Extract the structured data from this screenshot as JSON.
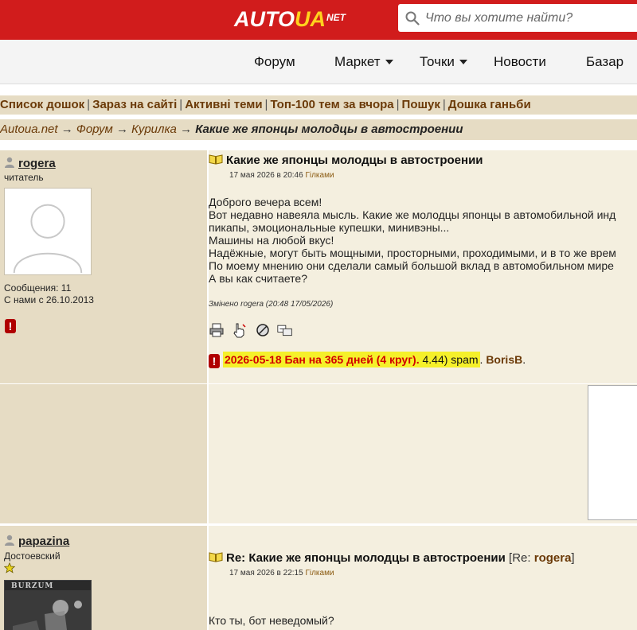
{
  "header": {
    "logo_main": "AUTO",
    "logo_ua": "UA",
    "logo_net": "NET",
    "search_placeholder": "Что вы хотите найти?",
    "colors": {
      "brand_red": "#d11c1c",
      "logo_yellow": "#ffd21e"
    }
  },
  "nav": {
    "items": [
      {
        "label": "Форум",
        "has_dropdown": false
      },
      {
        "label": "Маркет",
        "has_dropdown": true
      },
      {
        "label": "Точки",
        "has_dropdown": true
      },
      {
        "label": "Новости",
        "has_dropdown": false
      },
      {
        "label": "Базар",
        "has_dropdown": false
      }
    ]
  },
  "boards": {
    "links": [
      "Список дошок",
      "Зараз на сайті",
      "Активні теми",
      "Топ-100 тем за вчора",
      "Пошук",
      "Дошка ганьби"
    ],
    "separator": "|"
  },
  "breadcrumb": {
    "items": [
      "Autoua.net",
      "Форум",
      "Курилка"
    ],
    "current": "Какие же японцы молодцы в автостроении",
    "arrow": "→"
  },
  "posts": [
    {
      "username": "rogera",
      "rank": "читатель",
      "messages": "Сообщения: 11",
      "joined": "С нами с 26.10.2013",
      "title": "Какие же японцы молодцы в автостроении",
      "date": "17 мая 2026 в 20:46",
      "branch_link": "Гілками",
      "body": [
        "Доброго вечера всем!",
        "Вот недавно навеяла мысль. Какие же молодцы японцы в автомобильной инд",
        "пикапы, эмоциональные купешки, минивэны...",
        "Машины на любой вкус!",
        "Надёжные, могут быть мощными, просторными, проходимыми, и в то же врем",
        "По моему мнению они сделали самый большой вклад в автомобильном мире",
        "А вы как считаете?"
      ],
      "edited": "Змінено rogera (20:48 17/05/2026)",
      "ban": {
        "red_text": "2026-05-18 Бан на 365 дней (4 круг).",
        "reason": "4.44) spam",
        "moderator": "BorisB",
        "end": "."
      }
    },
    {
      "username": "papazina",
      "rank": "Достоевский",
      "title_prefix": "Re: Какие же японцы молодцы в автостроении",
      "ref_open": "[Re:",
      "ref_user": "rogera",
      "ref_close": "]",
      "date": "17 мая 2026 в 22:15",
      "branch_link": "Гілками",
      "body": [
        "Кто ты, бот неведомый?"
      ],
      "avatar_caption": "BURZUM"
    }
  ]
}
